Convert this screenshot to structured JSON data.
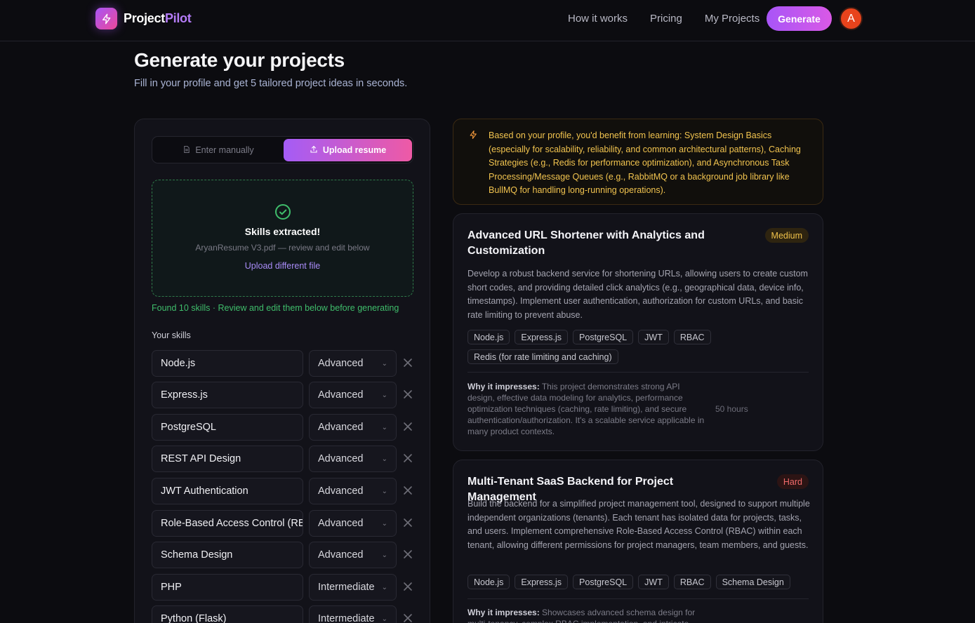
{
  "nav": {
    "logo_first": "Project",
    "logo_second": "Pilot",
    "links": [
      "How it works",
      "Pricing",
      "My Projects"
    ],
    "generate_label": "Generate",
    "avatar_initial": "A"
  },
  "header": {
    "title": "Generate your projects",
    "subtitle": "Fill in your profile and get 5 tailored project ideas in seconds."
  },
  "input_mode": {
    "manual_label": "Enter manually",
    "upload_label": "Upload resume",
    "selected": "Upload resume"
  },
  "upload": {
    "status": "Skills extracted!",
    "file_note": "AryanResume V3.pdf — review and edit below",
    "change_link": "Upload different file",
    "found_message": "Found 10 skills · Review and edit them below before generating"
  },
  "skills": {
    "label": "Your skills",
    "items": [
      {
        "name": "Node.js",
        "level": "Advanced"
      },
      {
        "name": "Express.js",
        "level": "Advanced"
      },
      {
        "name": "PostgreSQL",
        "level": "Advanced"
      },
      {
        "name": "REST API Design",
        "level": "Advanced"
      },
      {
        "name": "JWT Authentication",
        "level": "Advanced"
      },
      {
        "name": "Role-Based Access Control (RBAC)",
        "level": "Advanced"
      },
      {
        "name": "Schema Design",
        "level": "Advanced"
      },
      {
        "name": "PHP",
        "level": "Intermediate"
      },
      {
        "name": "Python (Flask)",
        "level": "Intermediate"
      }
    ]
  },
  "tip": {
    "text": "Based on your profile, you'd benefit from learning: System Design Basics (especially for scalability, reliability, and common architectural patterns), Caching Strategies (e.g., Redis for performance optimization), and Asynchronous Task Processing/Message Queues (e.g., RabbitMQ or a background job library like BullMQ for handling long-running operations).",
    "color": "#f2c44f"
  },
  "projects": [
    {
      "title": "Advanced URL Shortener with Analytics and Customization",
      "difficulty": "Medium",
      "description": "Develop a robust backend service for shortening URLs, allowing users to create custom short codes, and providing detailed click analytics (e.g., geographical data, device info, timestamps). Implement user authentication, authorization for custom URLs, and basic rate limiting to prevent abuse.",
      "tags": [
        "Node.js",
        "Express.js",
        "PostgreSQL",
        "JWT",
        "RBAC",
        "Redis (for rate limiting and caching)"
      ],
      "why_label": "Why it impresses:",
      "why_text": "This project demonstrates strong API design, effective data modeling for analytics, performance optimization techniques (caching, rate limiting), and secure authentication/authorization. It's a scalable service applicable in many product contexts.",
      "hours": "50 hours"
    },
    {
      "title": "Multi-Tenant SaaS Backend for Project Management",
      "difficulty": "Hard",
      "description": "Build the backend for a simplified project management tool, designed to support multiple independent organizations (tenants). Each tenant has isolated data for projects, tasks, and users. Implement comprehensive Role-Based Access Control (RBAC) within each tenant, allowing different permissions for project managers, team members, and guests.",
      "tags": [
        "Node.js",
        "Express.js",
        "PostgreSQL",
        "JWT",
        "RBAC",
        "Schema Design"
      ],
      "why_label": "Why it impresses:",
      "why_text": "Showcases advanced schema design for multi-tenancy, complex RBAC implementation, and intricate"
    }
  ],
  "colors": {
    "accent_start": "#a855f7",
    "accent_end": "#ec4899",
    "success": "#3fbd6b",
    "medium": "#f0c24a",
    "hard": "#f06a6a"
  }
}
